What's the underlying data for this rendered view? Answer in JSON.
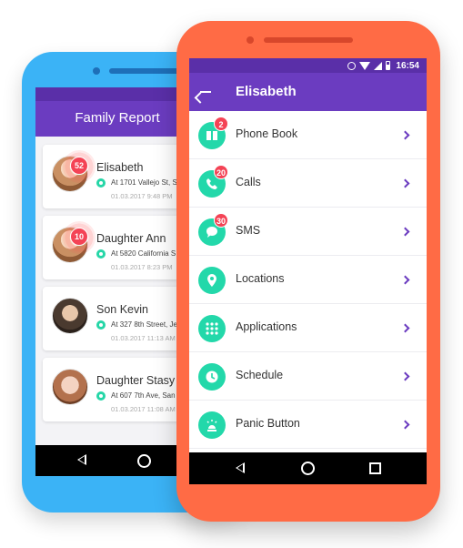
{
  "back_phone": {
    "header_title": "Family Report",
    "cards": [
      {
        "name": "Elisabeth",
        "address": "At 1701 Vallejo St, Sa",
        "date": "01.03.2017 9:48 PM",
        "badge": "52"
      },
      {
        "name": "Daughter Ann",
        "address": "At 5820 California S",
        "date": "01.03.2017 8:23 PM",
        "badge": "10"
      },
      {
        "name": "Son Kevin",
        "address": "At 327 8th Street, Je",
        "date": "01.03.2017 11:13 AM",
        "badge": ""
      },
      {
        "name": "Daughter Stasy",
        "address": "At 607 7th Ave, San F",
        "date": "01.03.2017 11:08 AM",
        "badge": ""
      }
    ]
  },
  "front_phone": {
    "status": {
      "time": "16:54"
    },
    "appbar_title": "Elisabeth",
    "menu": [
      {
        "label": "Phone Book",
        "badge": "2",
        "icon": "book-icon"
      },
      {
        "label": "Calls",
        "badge": "20",
        "icon": "phone-icon"
      },
      {
        "label": "SMS",
        "badge": "30",
        "icon": "chat-bubble-icon"
      },
      {
        "label": "Locations",
        "badge": "",
        "icon": "location-pin-icon"
      },
      {
        "label": "Applications",
        "badge": "",
        "icon": "apps-grid-icon"
      },
      {
        "label": "Schedule",
        "badge": "",
        "icon": "clock-icon"
      },
      {
        "label": "Panic Button",
        "badge": "",
        "icon": "alarm-siren-icon"
      }
    ]
  },
  "colors": {
    "blue_phone": "#3bb3f6",
    "orange_phone": "#ff6b45",
    "purple_header": "#6b3cc0",
    "accent_green": "#23d8aa",
    "badge_red": "#f44355"
  }
}
